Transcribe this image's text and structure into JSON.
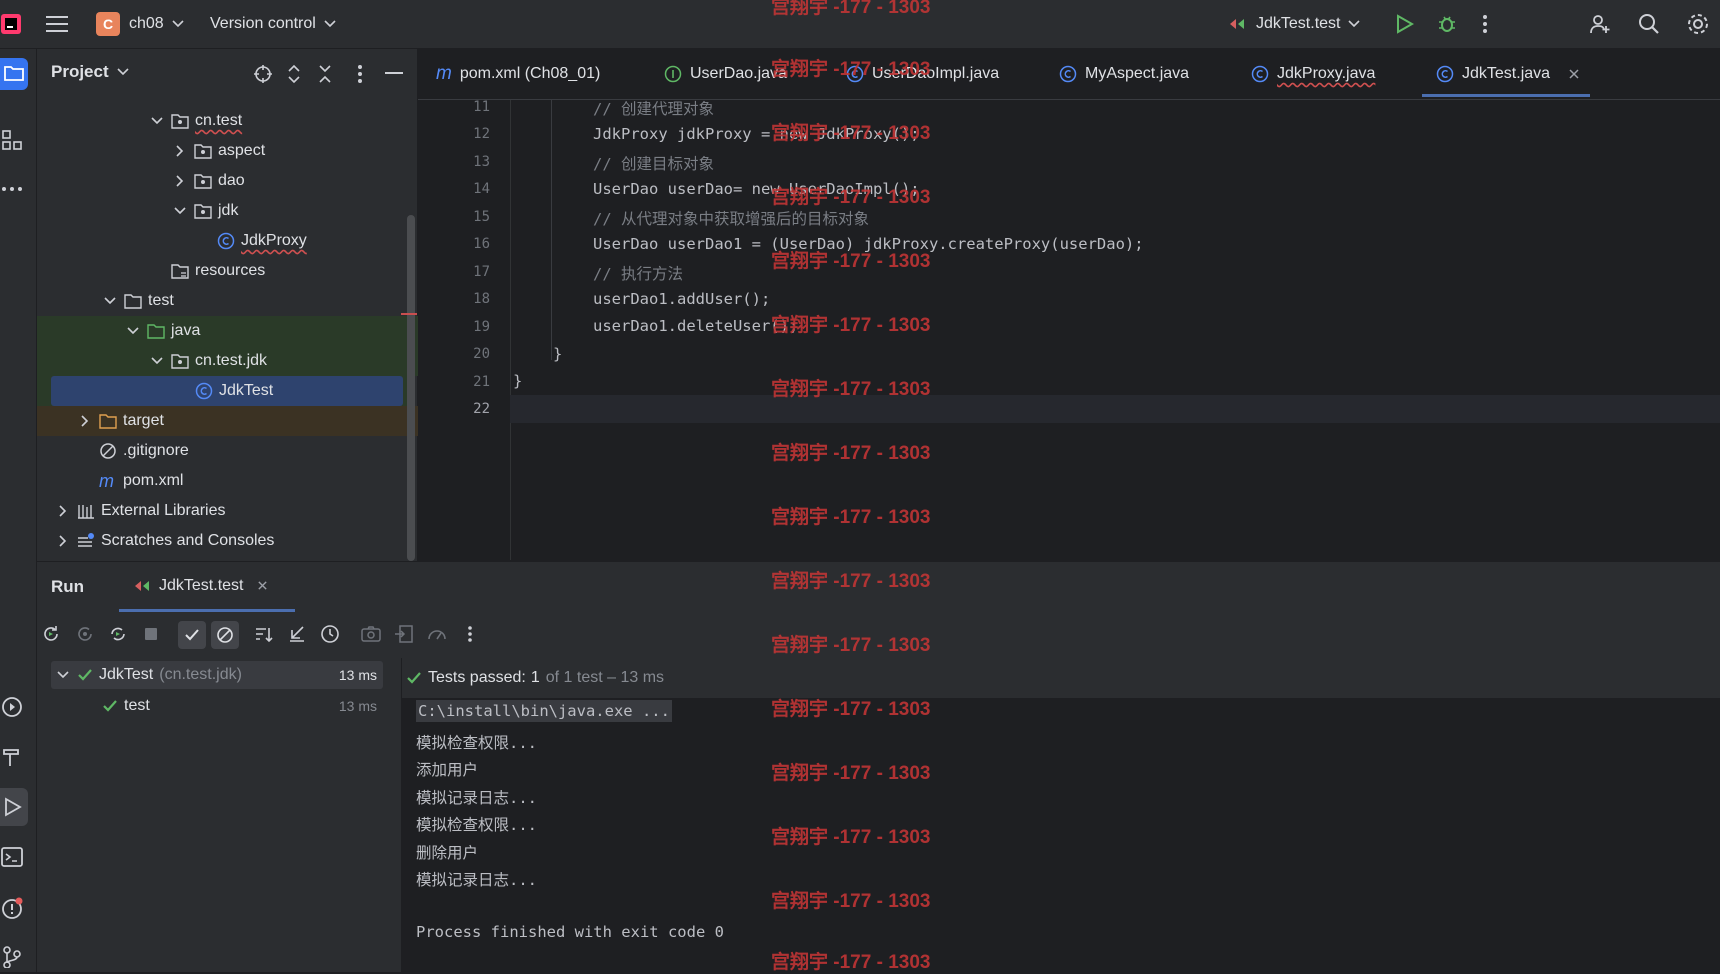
{
  "titlebar": {
    "project_badge": "C",
    "project_name": "ch08",
    "vcs_label": "Version control",
    "run_config": "JdkTest.test"
  },
  "project_panel": {
    "title": "Project",
    "tree": [
      {
        "label": "cn.test"
      },
      {
        "label": "aspect"
      },
      {
        "label": "dao"
      },
      {
        "label": "jdk"
      },
      {
        "label": "JdkProxy"
      },
      {
        "label": "resources"
      },
      {
        "label": "test"
      },
      {
        "label": "java"
      },
      {
        "label": "cn.test.jdk"
      },
      {
        "label": "JdkTest"
      },
      {
        "label": "target"
      },
      {
        "label": ".gitignore"
      },
      {
        "label": "pom.xml"
      },
      {
        "label": "External Libraries"
      },
      {
        "label": "Scratches and Consoles"
      }
    ]
  },
  "editor": {
    "tabs": [
      {
        "label": "pom.xml (Ch08_01)"
      },
      {
        "label": "UserDao.java"
      },
      {
        "label": "UserDaoImpl.java"
      },
      {
        "label": "MyAspect.java"
      },
      {
        "label": "JdkProxy.java"
      },
      {
        "label": "JdkTest.java"
      }
    ],
    "lines": [
      {
        "n": "11",
        "text": "// 创建代理对象"
      },
      {
        "n": "12",
        "text": "JdkProxy jdkProxy = new JdkProxy();"
      },
      {
        "n": "13",
        "text": "// 创建目标对象"
      },
      {
        "n": "14",
        "text": "UserDao userDao= new UserDaoImpl();"
      },
      {
        "n": "15",
        "text": "// 从代理对象中获取增强后的目标对象"
      },
      {
        "n": "16",
        "text": "UserDao userDao1 = (UserDao) jdkProxy.createProxy(userDao);"
      },
      {
        "n": "17",
        "text": "// 执行方法"
      },
      {
        "n": "18",
        "text": "userDao1.addUser();"
      },
      {
        "n": "19",
        "text": "userDao1.deleteUser();"
      },
      {
        "n": "20",
        "text": "}"
      },
      {
        "n": "21",
        "text": "}"
      },
      {
        "n": "22",
        "text": ""
      }
    ]
  },
  "run_panel": {
    "title": "Run",
    "tab_label": "JdkTest.test",
    "tree": {
      "suite_name": "JdkTest",
      "suite_pkg": "(cn.test.jdk)",
      "suite_time": "13 ms",
      "test_name": "test",
      "test_time": "13 ms"
    },
    "status": {
      "passed_label": "Tests passed:",
      "passed_count": "1",
      "detail": "of 1 test – 13 ms"
    },
    "console": [
      "C:\\install\\bin\\java.exe ...",
      "模拟检查权限...",
      "添加用户",
      "模拟记录日志...",
      "模拟检查权限...",
      "删除用户",
      "模拟记录日志...",
      "",
      "Process finished with exit code 0"
    ]
  },
  "watermark": "宫翔宇 -177 - 1303",
  "colors": {
    "accent": "#3574f0",
    "pass_green": "#5fb865",
    "watermark_red": "#c03535"
  }
}
